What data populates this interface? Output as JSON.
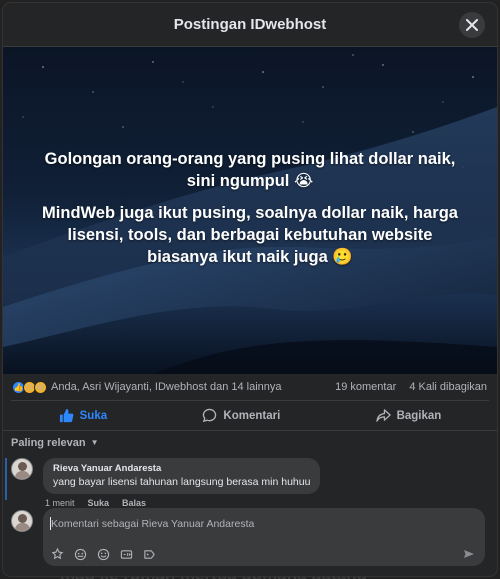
{
  "backdrop": {
    "text": "mau ke rumah mertua gumana datang"
  },
  "header": {
    "title": "Postingan IDwebhost"
  },
  "post": {
    "paragraph1": "Golongan orang-orang yang pusing lihat dollar naik, sini ngumpul 😭",
    "paragraph2": "MindWeb juga ikut pusing, soalnya dollar naik, harga lisensi, tools, dan berbagai kebutuhan website biasanya ikut naik juga 🥲"
  },
  "stats": {
    "reaction_icons": [
      "like-icon",
      "sad-icon",
      "haha-icon"
    ],
    "reactors": "Anda, Asri Wijayanti, IDwebhost dan 14 lainnya",
    "comments": "19 komentar",
    "shares": "4 Kali dibagikan"
  },
  "actions": {
    "like": "Suka",
    "comment": "Komentari",
    "share": "Bagikan"
  },
  "sort": {
    "label": "Paling relevan"
  },
  "comments": [
    {
      "author": "Rieva Yanuar Andaresta",
      "text": "yang bayar lisensi tahunan langsung berasa min huhuu",
      "time": "1 menit",
      "like": "Suka",
      "reply": "Balas"
    }
  ],
  "composer": {
    "placeholder": "Komentari sebagai Rieva Yanuar Andaresta",
    "tools": [
      "sticker-icon",
      "avatar-icon",
      "emoji-icon",
      "gif-icon",
      "label-icon"
    ]
  },
  "colors": {
    "accent": "#2d88ff",
    "surface": "#242526",
    "bubble": "#3a3b3c"
  }
}
